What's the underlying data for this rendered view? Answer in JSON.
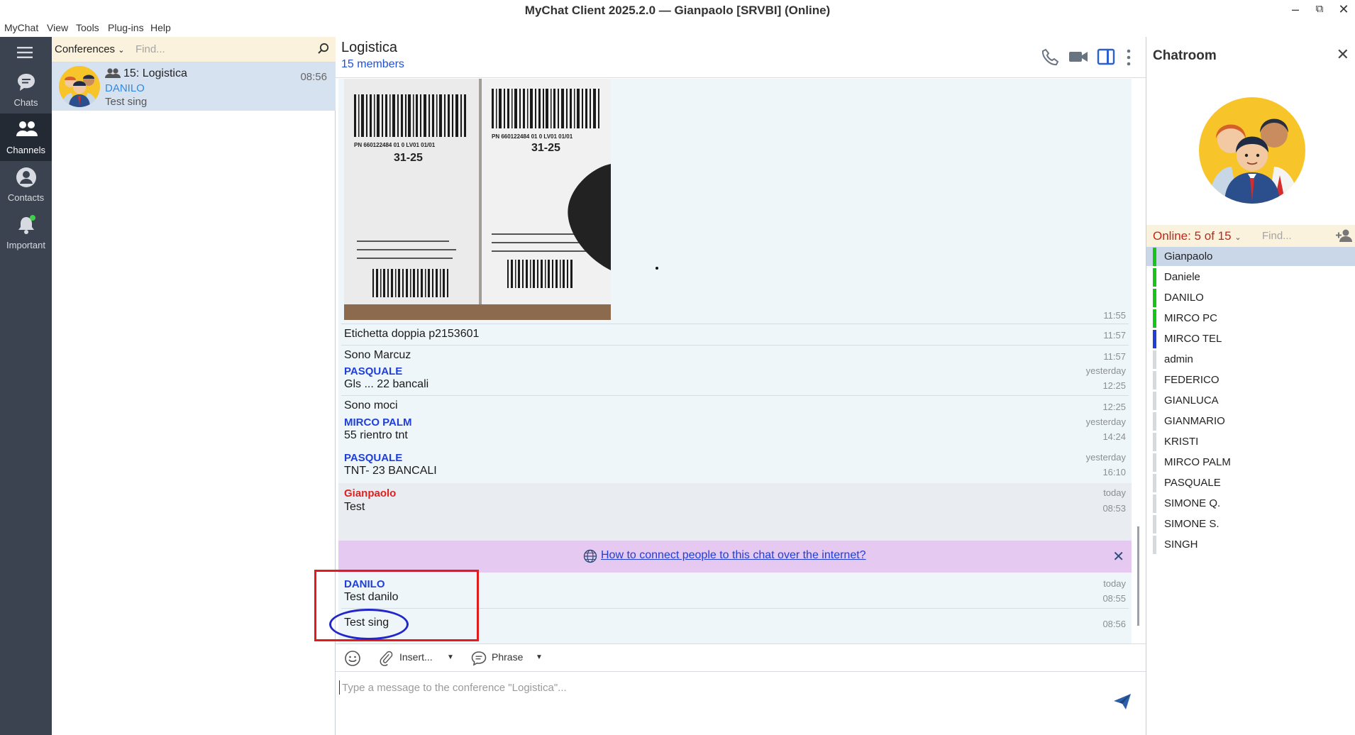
{
  "window": {
    "title": "MyChat Client 2025.2.0 — Gianpaolo [SRVBI] (Online)"
  },
  "menu": [
    "MyChat",
    "View",
    "Tools",
    "Plug-ins",
    "Help"
  ],
  "nav": [
    {
      "label": "Chats",
      "icon": "chat-bubble-icon",
      "active": false
    },
    {
      "label": "Channels",
      "icon": "people-icon",
      "active": true
    },
    {
      "label": "Contacts",
      "icon": "user-icon",
      "active": false
    },
    {
      "label": "Important",
      "icon": "bell-icon",
      "active": false
    }
  ],
  "list": {
    "dropdown": "Conferences",
    "search_placeholder": "Find...",
    "item": {
      "name": "15: Logistica",
      "author": "DANILO",
      "last": "Test sing",
      "time": "08:56"
    }
  },
  "chat": {
    "title": "Logistica",
    "members": "15 members",
    "photo_label_1": "PN 660122484 01 0 LV01 01/01",
    "photo_label_2": "31-25",
    "messages": [
      {
        "time": "11:55"
      },
      {
        "text": "Etichetta doppia p2153601",
        "time": "11:57"
      },
      {
        "text": "Sono Marcuz",
        "time": "11:57"
      },
      {
        "author": "PASQUALE",
        "day": "yesterday",
        "text": "Gls ... 22 bancali",
        "time": "12:25"
      },
      {
        "text": "Sono moci",
        "time": "12:25"
      },
      {
        "author": "MIRCO PALM",
        "day": "yesterday",
        "text": "55 rientro tnt",
        "time": "14:24"
      },
      {
        "author": "PASQUALE",
        "day": "yesterday",
        "text": "TNT- 23 BANCALI",
        "time": "16:10"
      },
      {
        "author": "Gianpaolo",
        "day": "today",
        "text": "Test",
        "time": "08:53"
      },
      {
        "author": "DANILO",
        "day": "today",
        "text": "Test danilo",
        "time": "08:55"
      },
      {
        "text": "Test sing",
        "time": "08:56"
      }
    ],
    "banner": {
      "link": "How to connect people to this chat over the internet?"
    },
    "toolbar": {
      "insert": "Insert...",
      "phrase": "Phrase"
    },
    "composer": {
      "placeholder": "Type a message to the conference \"Logistica\"..."
    }
  },
  "room": {
    "title": "Chatroom",
    "online": "Online: 5 of 15",
    "search_placeholder": "Find...",
    "members": [
      {
        "name": "Gianpaolo",
        "status": "#19c419"
      },
      {
        "name": "Daniele",
        "status": "#19c419"
      },
      {
        "name": "DANILO",
        "status": "#19c419"
      },
      {
        "name": "MIRCO PC",
        "status": "#19c419"
      },
      {
        "name": "MIRCO TEL",
        "status": "#1f3fd6"
      },
      {
        "name": "admin",
        "status": "#d6d9dd"
      },
      {
        "name": "FEDERICO",
        "status": "#d6d9dd"
      },
      {
        "name": "GIANLUCA",
        "status": "#d6d9dd"
      },
      {
        "name": "GIANMARIO",
        "status": "#d6d9dd"
      },
      {
        "name": "KRISTI",
        "status": "#d6d9dd"
      },
      {
        "name": "MIRCO PALM",
        "status": "#d6d9dd"
      },
      {
        "name": "PASQUALE",
        "status": "#d6d9dd"
      },
      {
        "name": "SIMONE Q.",
        "status": "#d6d9dd"
      },
      {
        "name": "SIMONE S.",
        "status": "#d6d9dd"
      },
      {
        "name": "SINGH",
        "status": "#d6d9dd"
      }
    ]
  }
}
